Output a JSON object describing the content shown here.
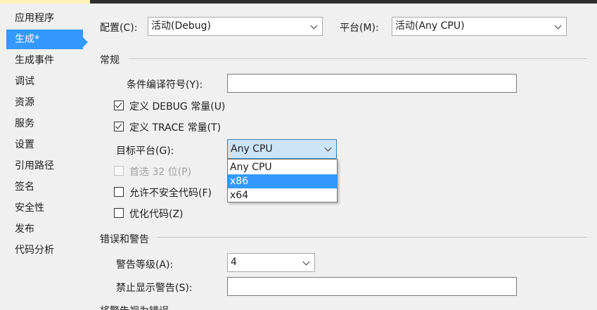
{
  "sidebar": {
    "items": [
      {
        "label": "应用程序"
      },
      {
        "label": "生成*",
        "active": true
      },
      {
        "label": "生成事件"
      },
      {
        "label": "调试"
      },
      {
        "label": "资源"
      },
      {
        "label": "服务"
      },
      {
        "label": "设置"
      },
      {
        "label": "引用路径"
      },
      {
        "label": "签名"
      },
      {
        "label": "安全性"
      },
      {
        "label": "发布"
      },
      {
        "label": "代码分析"
      }
    ]
  },
  "toolbar": {
    "configuration_label": "配置(C):",
    "configuration_value": "活动(Debug)",
    "platform_label": "平台(M):",
    "platform_value": "活动(Any CPU)"
  },
  "general": {
    "section_title": "常规",
    "conditional_symbols_label": "条件编译符号(Y):",
    "conditional_symbols_value": "",
    "define_debug_label": "定义 DEBUG 常量(U)",
    "define_debug_checked": true,
    "define_trace_label": "定义 TRACE 常量(T)",
    "define_trace_checked": true,
    "platform_target_label": "目标平台(G):",
    "platform_target_value": "Any CPU",
    "platform_target_options": [
      "Any CPU",
      "x86",
      "x64"
    ],
    "platform_target_highlighted": "x86",
    "prefer32_label": "首选 32 位(P)",
    "prefer32_checked": false,
    "prefer32_enabled": false,
    "allow_unsafe_label": "允许不安全代码(F)",
    "allow_unsafe_checked": false,
    "optimize_label": "优化代码(Z)",
    "optimize_checked": false
  },
  "errors": {
    "section_title": "错误和警告",
    "warning_level_label": "警告等级(A):",
    "warning_level_value": "4",
    "suppress_label": "禁止显示警告(S):",
    "suppress_value": "",
    "next_section_partial": "将警告视为错误"
  },
  "colors": {
    "accent": "#3399ff",
    "background": "#f0f0f0",
    "open_combo": "#cce4f7"
  }
}
